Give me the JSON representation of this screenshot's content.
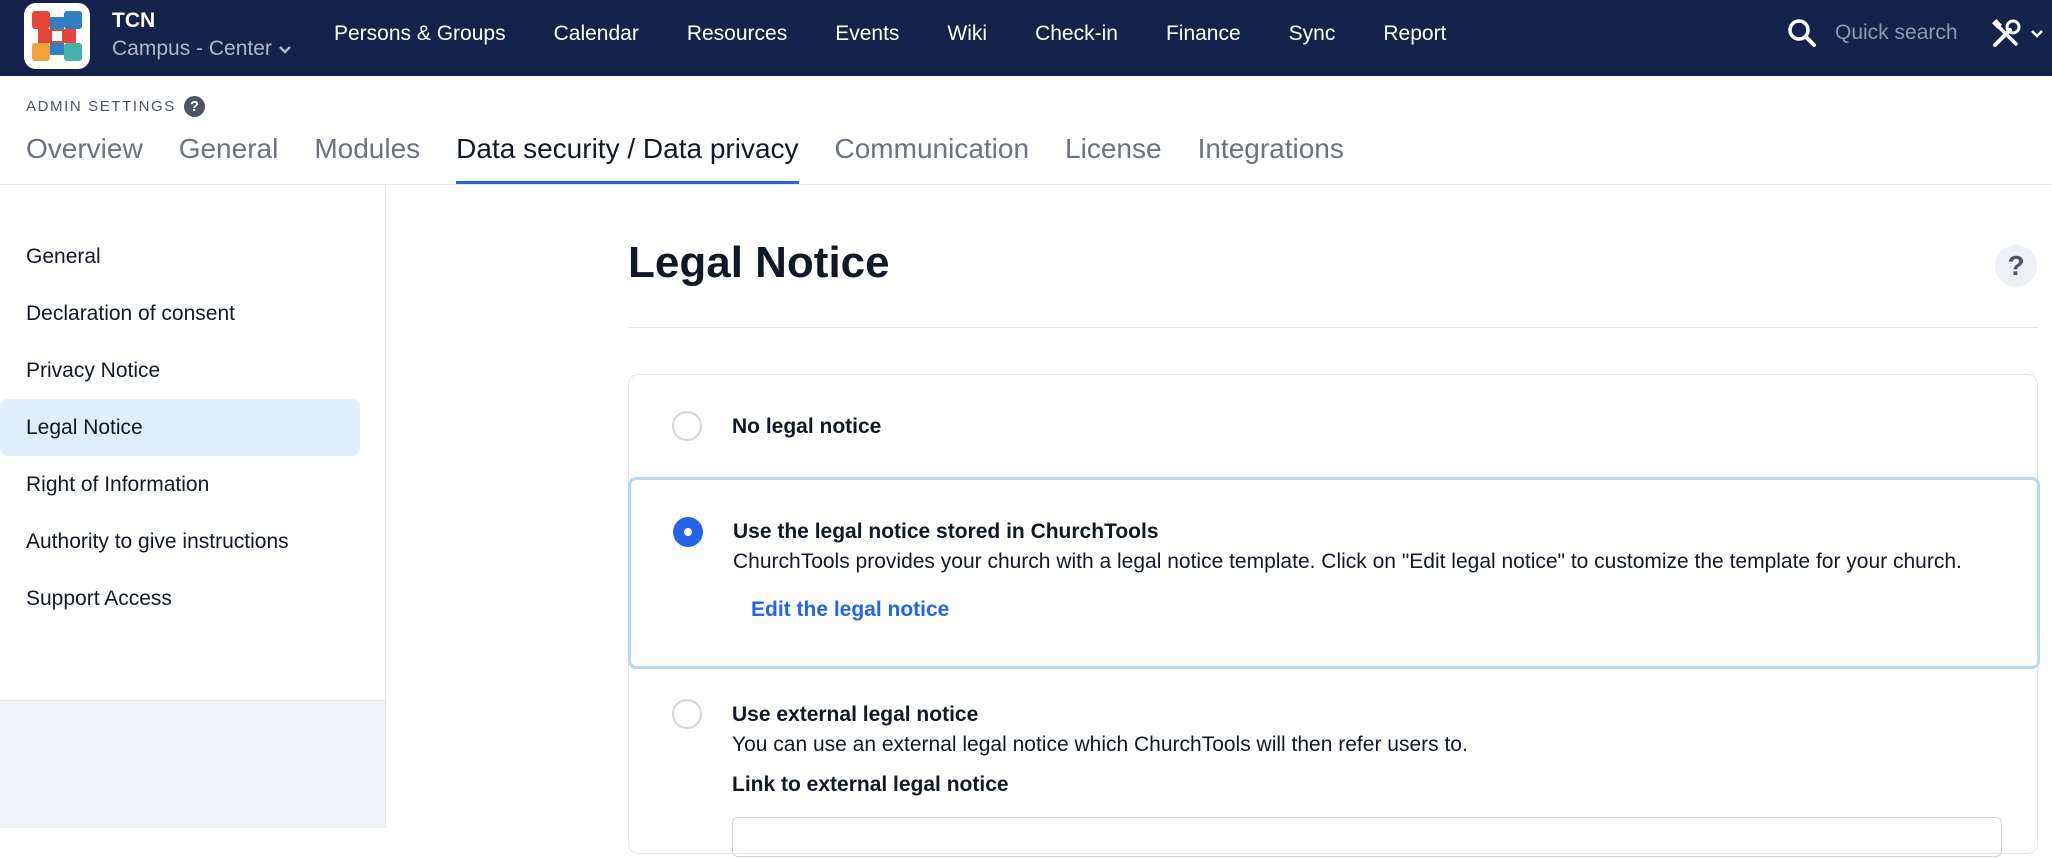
{
  "topbar": {
    "org_name": "TCN",
    "campus": "Campus - Center",
    "nav": [
      "Persons & Groups",
      "Calendar",
      "Resources",
      "Events",
      "Wiki",
      "Check-in",
      "Finance",
      "Sync",
      "Report"
    ],
    "search_placeholder": "Quick search",
    "colors": {
      "background": "#13234b",
      "logo_red": "#e4453b",
      "logo_blue": "#2f7fc1",
      "logo_teal": "#43b3a5",
      "logo_orange": "#f2a33a"
    }
  },
  "admin": {
    "label": "ADMIN SETTINGS",
    "tabs": [
      "Overview",
      "General",
      "Modules",
      "Data security / Data privacy",
      "Communication",
      "License",
      "Integrations"
    ],
    "active_tab": "Data security / Data privacy"
  },
  "sidebar": {
    "items": [
      "General",
      "Declaration of consent",
      "Privacy Notice",
      "Legal Notice",
      "Right of Information",
      "Authority to give instructions",
      "Support Access"
    ],
    "active": "Legal Notice"
  },
  "main": {
    "title": "Legal Notice",
    "options": [
      {
        "title": "No legal notice",
        "selected": false
      },
      {
        "title": "Use the legal notice stored in ChurchTools",
        "description": "ChurchTools provides your church with a legal notice template. Click on \"Edit legal notice\" to customize the template for your church.",
        "link": "Edit the legal notice",
        "selected": true
      },
      {
        "title": "Use external legal notice",
        "description": "You can use an external legal notice which ChurchTools will then refer users to.",
        "field_label": "Link to external legal notice",
        "selected": false
      }
    ],
    "accent_color": "#2563eb"
  }
}
